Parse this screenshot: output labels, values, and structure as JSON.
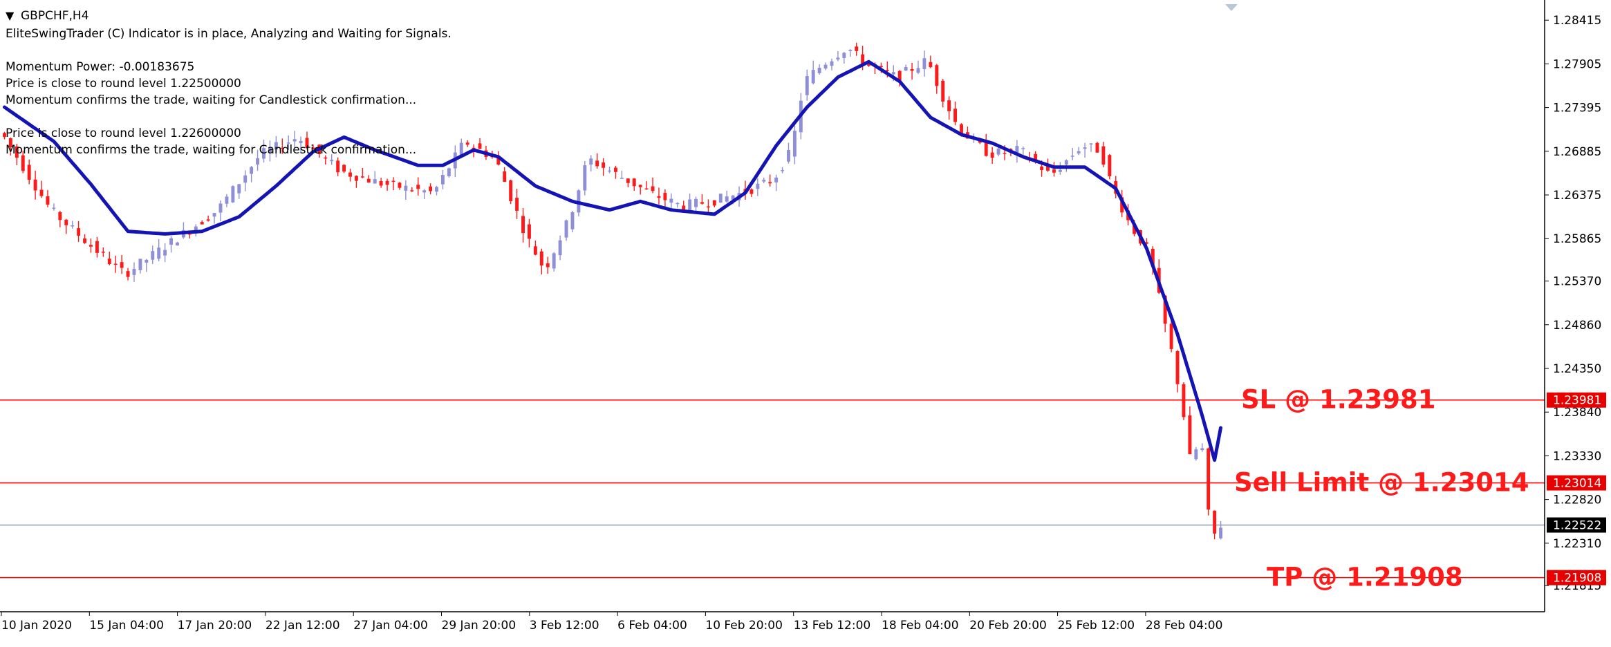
{
  "window": {
    "title": "GBPCHF,H4",
    "menu_glyph": "▼"
  },
  "indicator_text": [
    "EliteSwingTrader (C) Indicator is in place, Analyzing and Waiting for Signals.",
    "Momentum Power: -0.00183675",
    "Price is close to round level 1.22500000",
    "Momentum confirms the trade, waiting for Candlestick confirmation...",
    "Price is close to round level 1.22600000",
    "Momentum confirms the trade, waiting for Candlestick confirmation..."
  ],
  "colors": {
    "bull": "#8f8fd8",
    "bear": "#ff1a1a",
    "ma": "#1414b4",
    "level_line": "#ff0000",
    "current_line": "#7f8fa0",
    "annotation": "#ff1a1a",
    "axis": "#000000",
    "current_tag_bg": "#000000",
    "level_tag_bg": "#e60000"
  },
  "chart_data": {
    "type": "candlestick",
    "symbol": "GBPCHF",
    "timeframe": "H4",
    "ylim": [
      1.2155,
      1.2857
    ],
    "y_ticks": [
      "1.28415",
      "1.27905",
      "1.27395",
      "1.26885",
      "1.26375",
      "1.25865",
      "1.25370",
      "1.24860",
      "1.24350",
      "1.23840",
      "1.23330",
      "1.22820",
      "1.22310",
      "1.21815"
    ],
    "x_labels": [
      "10 Jan 2020",
      "15 Jan 04:00",
      "17 Jan 20:00",
      "22 Jan 12:00",
      "27 Jan 04:00",
      "29 Jan 20:00",
      "3 Feb 12:00",
      "6 Feb 04:00",
      "10 Feb 20:00",
      "13 Feb 12:00",
      "18 Feb 04:00",
      "20 Feb 20:00",
      "25 Feb 12:00",
      "28 Feb 04:00"
    ],
    "candle_count": 198,
    "price_path": [
      [
        0,
        1.271
      ],
      [
        8,
        1.262
      ],
      [
        15,
        1.2575
      ],
      [
        20,
        1.2545
      ],
      [
        28,
        1.2585
      ],
      [
        35,
        1.262
      ],
      [
        42,
        1.2685
      ],
      [
        48,
        1.2705
      ],
      [
        55,
        1.2665
      ],
      [
        62,
        1.265
      ],
      [
        70,
        1.264
      ],
      [
        75,
        1.27
      ],
      [
        80,
        1.268
      ],
      [
        85,
        1.259
      ],
      [
        88,
        1.255
      ],
      [
        92,
        1.261
      ],
      [
        95,
        1.268
      ],
      [
        100,
        1.266
      ],
      [
        105,
        1.264
      ],
      [
        110,
        1.2625
      ],
      [
        115,
        1.263
      ],
      [
        120,
        1.264
      ],
      [
        125,
        1.2655
      ],
      [
        128,
        1.269
      ],
      [
        130,
        1.277
      ],
      [
        133,
        1.279
      ],
      [
        137,
        1.281
      ],
      [
        140,
        1.279
      ],
      [
        145,
        1.2775
      ],
      [
        150,
        1.2795
      ],
      [
        152,
        1.276
      ],
      [
        155,
        1.2715
      ],
      [
        160,
        1.2685
      ],
      [
        165,
        1.269
      ],
      [
        170,
        1.266
      ],
      [
        175,
        1.2695
      ],
      [
        178,
        1.269
      ],
      [
        180,
        1.2645
      ],
      [
        183,
        1.26
      ],
      [
        186,
        1.257
      ],
      [
        188,
        1.25
      ],
      [
        190,
        1.244
      ],
      [
        192,
        1.236
      ],
      [
        193,
        1.23
      ],
      [
        194,
        1.238
      ],
      [
        195,
        1.23
      ],
      [
        196,
        1.223
      ],
      [
        197,
        1.2252
      ]
    ],
    "moving_average": {
      "name": "",
      "points": [
        [
          0,
          1.274
        ],
        [
          8,
          1.27
        ],
        [
          14,
          1.265
        ],
        [
          20,
          1.2595
        ],
        [
          26,
          1.2592
        ],
        [
          32,
          1.2595
        ],
        [
          38,
          1.2612
        ],
        [
          44,
          1.2648
        ],
        [
          50,
          1.2688
        ],
        [
          55,
          1.2705
        ],
        [
          60,
          1.269
        ],
        [
          67,
          1.2672
        ],
        [
          71,
          1.2672
        ],
        [
          76,
          1.269
        ],
        [
          80,
          1.2682
        ],
        [
          86,
          1.2648
        ],
        [
          92,
          1.263
        ],
        [
          98,
          1.262
        ],
        [
          103,
          1.263
        ],
        [
          108,
          1.262
        ],
        [
          115,
          1.2615
        ],
        [
          120,
          1.264
        ],
        [
          125,
          1.2695
        ],
        [
          130,
          1.274
        ],
        [
          135,
          1.2775
        ],
        [
          140,
          1.2793
        ],
        [
          145,
          1.277
        ],
        [
          150,
          1.2728
        ],
        [
          155,
          1.2708
        ],
        [
          160,
          1.2698
        ],
        [
          165,
          1.2682
        ],
        [
          170,
          1.267
        ],
        [
          175,
          1.267
        ],
        [
          180,
          1.2645
        ],
        [
          185,
          1.2575
        ],
        [
          190,
          1.2475
        ],
        [
          194,
          1.238
        ],
        [
          196,
          1.2328
        ],
        [
          197.3,
          1.2377
        ]
      ]
    },
    "levels": [
      {
        "label": "SL @ 1.23981",
        "price": 1.23981,
        "tag": "1.23981"
      },
      {
        "label": "Sell Limit @ 1.23014",
        "price": 1.23014,
        "tag": "1.23014"
      },
      {
        "label": "TP @ 1.21908",
        "price": 1.21908,
        "tag": "1.21908"
      }
    ],
    "current_price": {
      "price": 1.22522,
      "tag": "1.22522"
    }
  }
}
